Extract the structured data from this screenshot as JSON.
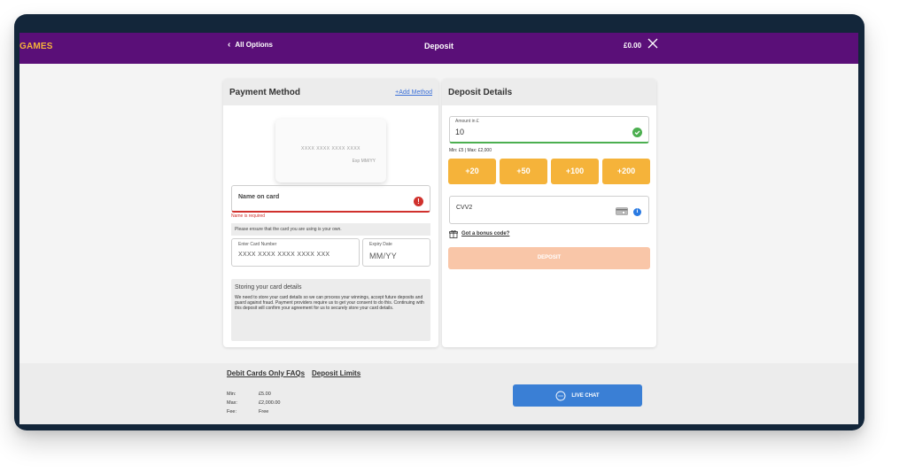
{
  "header": {
    "brand": "GAMES",
    "back_label": "All Options",
    "title": "Deposit",
    "balance": "£0.00"
  },
  "payment_method": {
    "title": "Payment Method",
    "add_method": "+Add Method",
    "card_preview": {
      "number": "XXXX XXXX XXXX XXXX",
      "expiry": "Exp MM/YY"
    },
    "name_on_card": {
      "label": "Name on card",
      "error": "Name is required"
    },
    "hint": "Please ensure that the card you are using is your own.",
    "card_number": {
      "label": "Enter Card Number",
      "placeholder": "XXXX XXXX XXXX XXXX XXX"
    },
    "expiry": {
      "label": "Expiry Date",
      "placeholder": "MM/YY"
    },
    "storing": {
      "title": "Storing your card details",
      "text": "We need to store your card details so we can process your winnings, accept future deposits and guard against fraud. Payment providers require us to get your consent to do this. Continuing with this deposit will confirm your agreement for us to securely store your card details."
    }
  },
  "deposit_details": {
    "title": "Deposit Details",
    "amount": {
      "label": "Amount in £",
      "value": "10"
    },
    "minmax": "Min: £5  |  Max: £2,000",
    "quick_amounts": [
      "+20",
      "+50",
      "+100",
      "+200"
    ],
    "cvv_label": "CVV2",
    "bonus_link": "Got a bonus code?",
    "deposit_button": "DEPOSIT"
  },
  "footer": {
    "links": [
      "Debit Cards Only FAQs",
      "Deposit Limits"
    ],
    "limits": [
      {
        "key": "Min:",
        "value": "£5.00"
      },
      {
        "key": "Max:",
        "value": "£2,000.00"
      },
      {
        "key": "Fee:",
        "value": "Free"
      }
    ],
    "live_chat": "LIVE CHAT"
  },
  "colors": {
    "topbar": "#5a0f78",
    "brand": "#f5b33a",
    "quick_buttons": "#f5b33a",
    "deposit_disabled": "#f9c6a8",
    "live_chat": "#3a7fd5",
    "error": "#d0312d",
    "success": "#4caf50"
  },
  "icons": [
    "chevron-left-icon",
    "close-icon",
    "error-icon",
    "check-icon",
    "card-icon",
    "info-icon",
    "gift-icon",
    "chat-icon"
  ]
}
